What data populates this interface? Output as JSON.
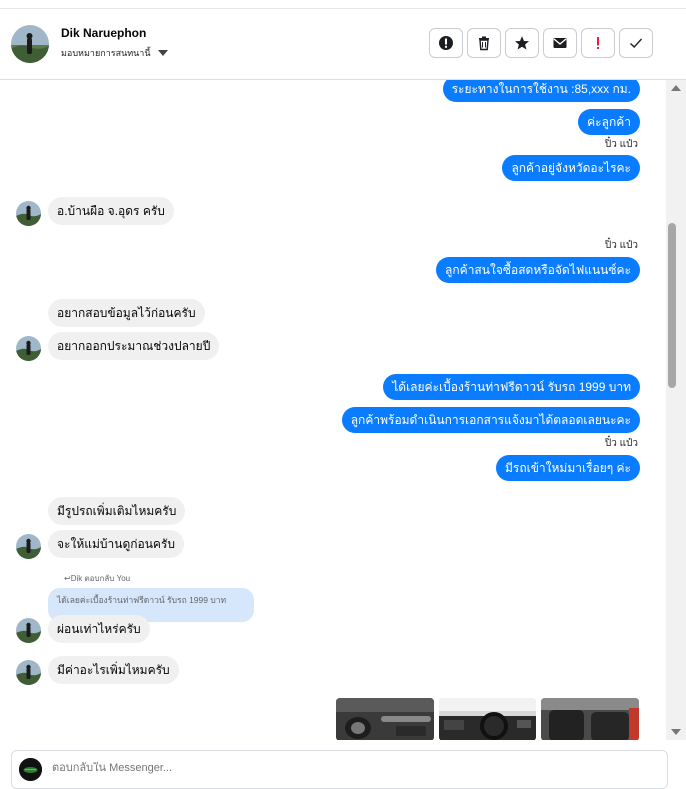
{
  "header": {
    "name": "Dik Naruephon",
    "subtitle": "มอบหมายการสนทนานี้"
  },
  "actions": [
    {
      "icon": "alert-circle-icon"
    },
    {
      "icon": "trash-icon"
    },
    {
      "icon": "star-icon"
    },
    {
      "icon": "envelope-icon"
    },
    {
      "icon": "exclamation-icon",
      "color": "#e41e3f"
    },
    {
      "icon": "check-icon"
    }
  ],
  "messages": {
    "m1": "ระยะทางในการใช้งาน :85,xxx กม.",
    "m2": "ค่ะลูกค้า",
    "seen1": "ปิ๋ว แป๋ว",
    "m3": "ลูกค้าอยู่จังหวัดอะไรคะ",
    "m4": "อ.บ้านผือ จ.อุดร ครับ",
    "seen2": "ปิ๋ว แป๋ว",
    "m5": "ลูกค้าสนใจซื้อสดหรือจัดไฟแนนซ์คะ",
    "m6": "อยากสอบข้อมูลไว้ก่อนครับ",
    "m7": "อยากออกประมาณช่วงปลายปี",
    "m8": "ได้เลยค่ะเบื้องร้านท่าฟรีดาวน์ รับรถ 1999 บาท",
    "m9": "ลูกค้าพร้อมดำเนินการเอกสารแจ้งมาได้ตลอดเลยนะคะ",
    "seen3": "ปิ๋ว แป๋ว",
    "m10": "มีรถเข้าใหม่มาเรื่อยๆ ค่ะ",
    "m11": "มีรูปรถเพิ่มเติมไหมครับ",
    "m12": "จะให้แม่บ้านดูก่อนครับ",
    "reply_note": "↩Dik ตอบกลับ You",
    "quoted": "ได้เลยค่ะเบื้องร้านท่าฟรีดาวน์ รับรถ 1999 บาท",
    "m13": "ผ่อนเท่าไหร่ครับ",
    "m14": "มีค่าอะไรเพิ่มไหมครับ"
  },
  "composer": {
    "placeholder": "ตอบกลับใน Messenger..."
  },
  "colors": {
    "outgoing": "#0a7cff",
    "incoming": "#f0f0f0",
    "quoted": "#d6e6fb"
  }
}
